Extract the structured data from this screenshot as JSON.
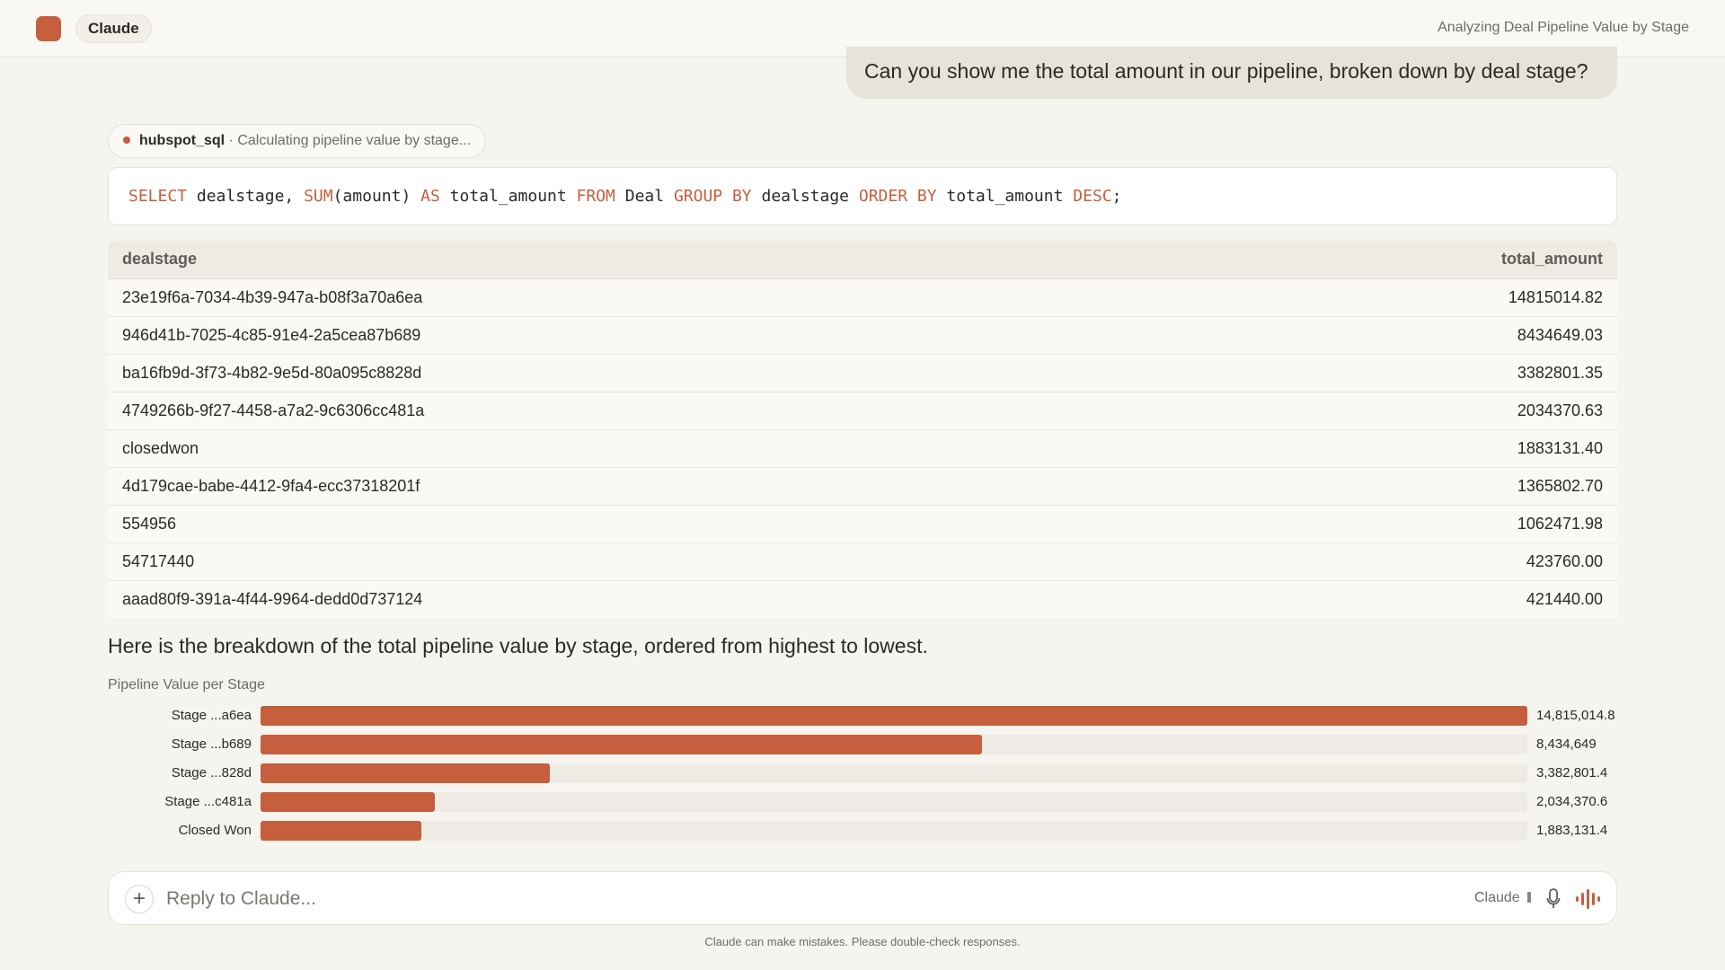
{
  "header": {
    "model_label": "Claude",
    "conversation_title": "Analyzing Deal Pipeline Value by Stage"
  },
  "user_message": "Can you show me the total amount in our pipeline, broken down by deal stage?",
  "tool_call": {
    "name": "hubspot_sql",
    "status": " · Calculating pipeline value by stage..."
  },
  "sql": {
    "t1": "SELECT",
    "t2": " dealstage, ",
    "t3": "SUM",
    "t4": "(amount) ",
    "t5": "AS",
    "t6": " total_amount ",
    "t7": "FROM",
    "t8": " Deal ",
    "t9": "GROUP BY",
    "t10": " dealstage ",
    "t11": "ORDER BY",
    "t12": " total_amount ",
    "t13": "DESC",
    "t14": ";"
  },
  "table": {
    "columns": [
      "dealstage",
      "total_amount"
    ],
    "rows": [
      [
        "23e19f6a-7034-4b39-947a-b08f3a70a6ea",
        "14815014.82"
      ],
      [
        "946d41b-7025-4c85-91e4-2a5cea87b689",
        "8434649.03"
      ],
      [
        "ba16fb9d-3f73-4b82-9e5d-80a095c8828d",
        "3382801.35"
      ],
      [
        "4749266b-9f27-4458-a7a2-9c6306cc481a",
        "2034370.63"
      ],
      [
        "closedwon",
        "1883131.40"
      ],
      [
        "4d179cae-babe-4412-9fa4-ecc37318201f",
        "1365802.70"
      ],
      [
        "554956",
        "1062471.98"
      ],
      [
        "54717440",
        "423760.00"
      ],
      [
        "aaad80f9-391a-4f44-9964-dedd0d737124",
        "421440.00"
      ]
    ]
  },
  "assistant_message": "Here is the breakdown of the total pipeline value by stage, ordered from highest to lowest.",
  "chart_data": {
    "type": "bar",
    "orientation": "horizontal",
    "title": "Pipeline Value per Stage",
    "categories": [
      "Stage ...a6ea",
      "Stage ...b689",
      "Stage ...828d",
      "Stage ...c481a",
      "Closed Won"
    ],
    "values": [
      14815014.8,
      8434649,
      3382801.4,
      2034370.6,
      1883131.4
    ],
    "value_labels": [
      "14,815,014.8",
      "8,434,649",
      "3,382,801.4",
      "2,034,370.6",
      "1,883,131.4"
    ],
    "xlim": [
      0,
      14815014.8
    ],
    "bar_color": "#c55f3e",
    "track_color": "#edebe4",
    "grid": false
  },
  "composer": {
    "placeholder": "Reply to Claude...",
    "model_label": "Claude",
    "plus_icon": "+"
  },
  "icons": {
    "add": "plus-icon",
    "mic": "microphone-icon",
    "voice": "voice-waveform-icon"
  },
  "disclaimer": "Claude can make mistakes. Please double-check responses.",
  "colors": {
    "accent": "#c55f3e",
    "background": "#f5f4ef",
    "user_bubble": "#e6e3d8"
  }
}
